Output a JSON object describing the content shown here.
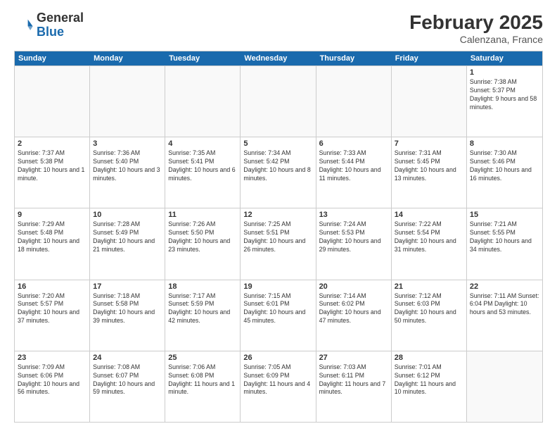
{
  "logo": {
    "general": "General",
    "blue": "Blue"
  },
  "title": {
    "month_year": "February 2025",
    "location": "Calenzana, France"
  },
  "header": {
    "days": [
      "Sunday",
      "Monday",
      "Tuesday",
      "Wednesday",
      "Thursday",
      "Friday",
      "Saturday"
    ]
  },
  "weeks": [
    [
      {
        "day": "",
        "info": ""
      },
      {
        "day": "",
        "info": ""
      },
      {
        "day": "",
        "info": ""
      },
      {
        "day": "",
        "info": ""
      },
      {
        "day": "",
        "info": ""
      },
      {
        "day": "",
        "info": ""
      },
      {
        "day": "1",
        "info": "Sunrise: 7:38 AM\nSunset: 5:37 PM\nDaylight: 9 hours and 58 minutes."
      }
    ],
    [
      {
        "day": "2",
        "info": "Sunrise: 7:37 AM\nSunset: 5:38 PM\nDaylight: 10 hours and 1 minute."
      },
      {
        "day": "3",
        "info": "Sunrise: 7:36 AM\nSunset: 5:40 PM\nDaylight: 10 hours and 3 minutes."
      },
      {
        "day": "4",
        "info": "Sunrise: 7:35 AM\nSunset: 5:41 PM\nDaylight: 10 hours and 6 minutes."
      },
      {
        "day": "5",
        "info": "Sunrise: 7:34 AM\nSunset: 5:42 PM\nDaylight: 10 hours and 8 minutes."
      },
      {
        "day": "6",
        "info": "Sunrise: 7:33 AM\nSunset: 5:44 PM\nDaylight: 10 hours and 11 minutes."
      },
      {
        "day": "7",
        "info": "Sunrise: 7:31 AM\nSunset: 5:45 PM\nDaylight: 10 hours and 13 minutes."
      },
      {
        "day": "8",
        "info": "Sunrise: 7:30 AM\nSunset: 5:46 PM\nDaylight: 10 hours and 16 minutes."
      }
    ],
    [
      {
        "day": "9",
        "info": "Sunrise: 7:29 AM\nSunset: 5:48 PM\nDaylight: 10 hours and 18 minutes."
      },
      {
        "day": "10",
        "info": "Sunrise: 7:28 AM\nSunset: 5:49 PM\nDaylight: 10 hours and 21 minutes."
      },
      {
        "day": "11",
        "info": "Sunrise: 7:26 AM\nSunset: 5:50 PM\nDaylight: 10 hours and 23 minutes."
      },
      {
        "day": "12",
        "info": "Sunrise: 7:25 AM\nSunset: 5:51 PM\nDaylight: 10 hours and 26 minutes."
      },
      {
        "day": "13",
        "info": "Sunrise: 7:24 AM\nSunset: 5:53 PM\nDaylight: 10 hours and 29 minutes."
      },
      {
        "day": "14",
        "info": "Sunrise: 7:22 AM\nSunset: 5:54 PM\nDaylight: 10 hours and 31 minutes."
      },
      {
        "day": "15",
        "info": "Sunrise: 7:21 AM\nSunset: 5:55 PM\nDaylight: 10 hours and 34 minutes."
      }
    ],
    [
      {
        "day": "16",
        "info": "Sunrise: 7:20 AM\nSunset: 5:57 PM\nDaylight: 10 hours and 37 minutes."
      },
      {
        "day": "17",
        "info": "Sunrise: 7:18 AM\nSunset: 5:58 PM\nDaylight: 10 hours and 39 minutes."
      },
      {
        "day": "18",
        "info": "Sunrise: 7:17 AM\nSunset: 5:59 PM\nDaylight: 10 hours and 42 minutes."
      },
      {
        "day": "19",
        "info": "Sunrise: 7:15 AM\nSunset: 6:01 PM\nDaylight: 10 hours and 45 minutes."
      },
      {
        "day": "20",
        "info": "Sunrise: 7:14 AM\nSunset: 6:02 PM\nDaylight: 10 hours and 47 minutes."
      },
      {
        "day": "21",
        "info": "Sunrise: 7:12 AM\nSunset: 6:03 PM\nDaylight: 10 hours and 50 minutes."
      },
      {
        "day": "22",
        "info": "Sunrise: 7:11 AM\nSunset: 6:04 PM\nDaylight: 10 hours and 53 minutes."
      }
    ],
    [
      {
        "day": "23",
        "info": "Sunrise: 7:09 AM\nSunset: 6:06 PM\nDaylight: 10 hours and 56 minutes."
      },
      {
        "day": "24",
        "info": "Sunrise: 7:08 AM\nSunset: 6:07 PM\nDaylight: 10 hours and 59 minutes."
      },
      {
        "day": "25",
        "info": "Sunrise: 7:06 AM\nSunset: 6:08 PM\nDaylight: 11 hours and 1 minute."
      },
      {
        "day": "26",
        "info": "Sunrise: 7:05 AM\nSunset: 6:09 PM\nDaylight: 11 hours and 4 minutes."
      },
      {
        "day": "27",
        "info": "Sunrise: 7:03 AM\nSunset: 6:11 PM\nDaylight: 11 hours and 7 minutes."
      },
      {
        "day": "28",
        "info": "Sunrise: 7:01 AM\nSunset: 6:12 PM\nDaylight: 11 hours and 10 minutes."
      },
      {
        "day": "",
        "info": ""
      }
    ]
  ]
}
